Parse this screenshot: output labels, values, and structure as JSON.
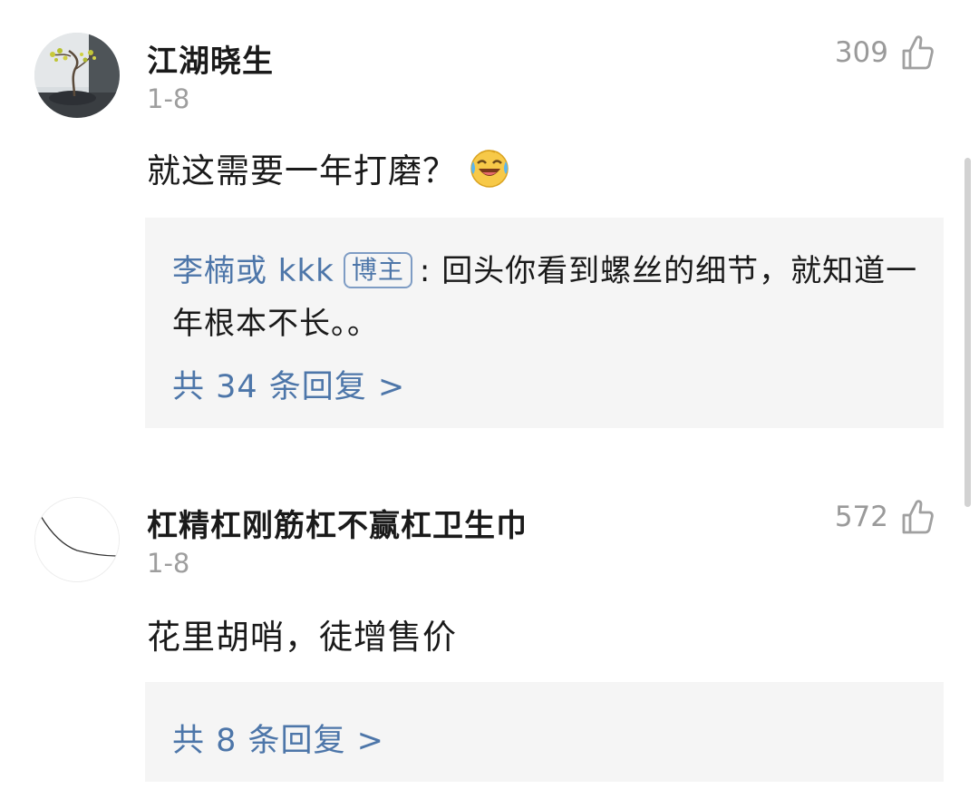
{
  "comments": [
    {
      "username": "江湖晓生",
      "date": "1-8",
      "likes": "309",
      "text": "就这需要一年打磨？",
      "reply_preview": {
        "author": "李楠或 kkk",
        "badge": "博主",
        "separator": ":",
        "text": "回头你看到螺丝的细节，就知道一年根本不长。。"
      },
      "reply_link": "共 34 条回复 >"
    },
    {
      "username": "杠精杠刚筋杠不赢杠卫生巾",
      "date": "1-8",
      "likes": "572",
      "text": "花里胡哨，徒增售价",
      "reply_link": "共 8 条回复 >"
    }
  ],
  "icons": {
    "like": "thumbs-up-icon",
    "emoji": "laughing-crying-emoji-icon"
  },
  "colors": {
    "link": "#4d76a9",
    "muted": "#9e9e9e",
    "reply_bg": "#f5f5f5"
  }
}
